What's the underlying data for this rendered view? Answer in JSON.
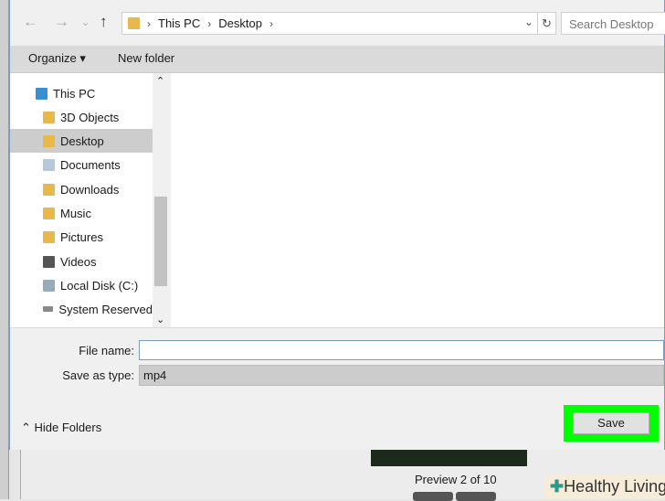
{
  "nav": {
    "breadcrumb": [
      "This PC",
      "Desktop"
    ],
    "search_placeholder": "Search Desktop"
  },
  "toolbar": {
    "organize": "Organize ▾",
    "new_folder": "New folder"
  },
  "sidebar": {
    "items": [
      {
        "label": "This PC",
        "icon": "computer-icon"
      },
      {
        "label": "3D Objects",
        "icon": "folder-3d-icon"
      },
      {
        "label": "Desktop",
        "icon": "desktop-folder-icon",
        "selected": true
      },
      {
        "label": "Documents",
        "icon": "documents-icon"
      },
      {
        "label": "Downloads",
        "icon": "downloads-icon"
      },
      {
        "label": "Music",
        "icon": "music-icon"
      },
      {
        "label": "Pictures",
        "icon": "pictures-icon"
      },
      {
        "label": "Videos",
        "icon": "videos-icon"
      },
      {
        "label": "Local Disk (C:)",
        "icon": "disk-icon"
      },
      {
        "label": "System Reserved",
        "icon": "drive-icon"
      }
    ]
  },
  "form": {
    "file_name_label": "File name:",
    "file_name_value": "",
    "save_type_label": "Save as type:",
    "save_type_value": "mp4"
  },
  "footer": {
    "hide_folders": "Hide Folders",
    "save": "Save"
  },
  "background": {
    "preview": "Preview 2 of 10",
    "logo": "Healthy Living"
  }
}
